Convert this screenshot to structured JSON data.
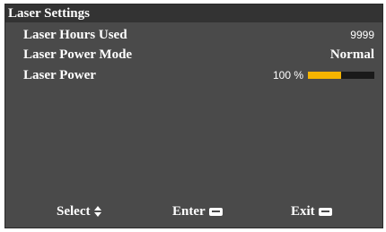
{
  "menu": {
    "title": "Laser Settings",
    "items": [
      {
        "label": "Laser Hours Used",
        "value": "9999"
      },
      {
        "label": "Laser Power Mode",
        "value": "Normal"
      },
      {
        "label": "Laser Power",
        "value": "100 %",
        "level": 0.5
      }
    ]
  },
  "footer": {
    "select_label": "Select",
    "enter_label": "Enter",
    "exit_label": "Exit"
  },
  "colors": {
    "panel_bg": "#4a4a4a",
    "title_bg": "#333333",
    "bar_fill": "#f5b400",
    "bar_track": "#1a1a1a"
  },
  "icons": {
    "select": "up-down-arrows-icon",
    "enter": "enter-key-icon",
    "exit": "menu-key-icon"
  }
}
